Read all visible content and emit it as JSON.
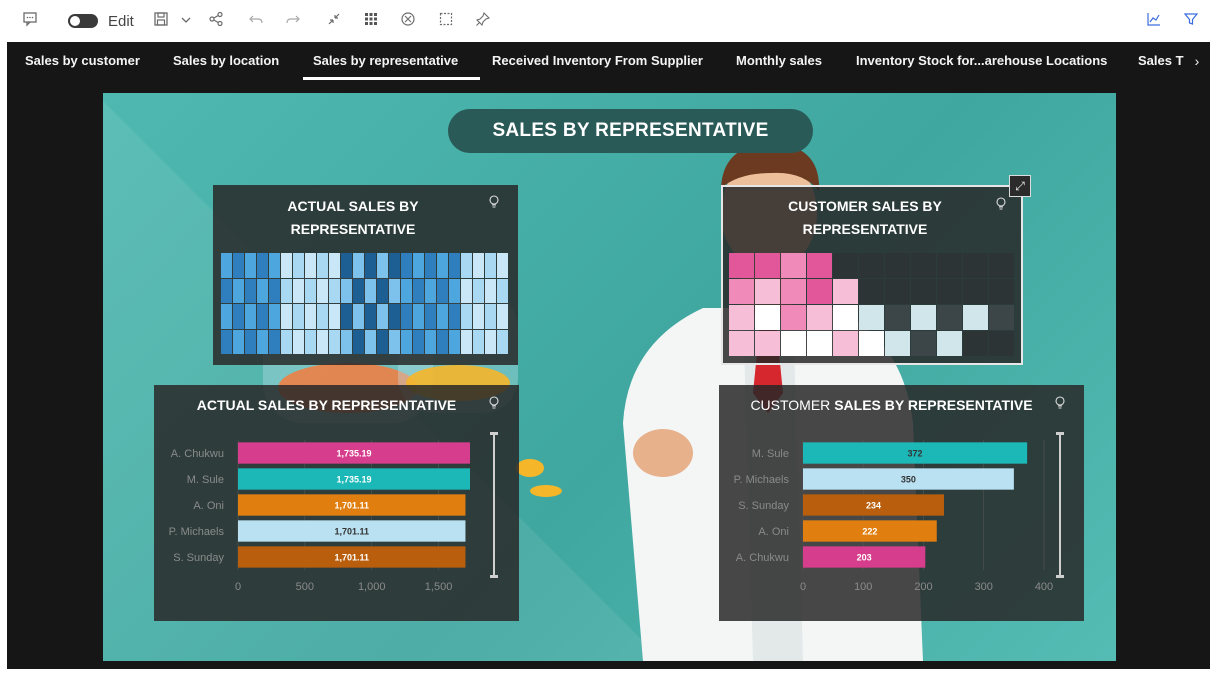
{
  "toolbar": {
    "edit_label": "Edit",
    "icons": [
      "comment-icon",
      "toggle",
      "save-icon",
      "chevron-down-icon",
      "share-icon",
      "undo-icon",
      "redo-icon",
      "fit-icon",
      "grid-icon",
      "target-icon",
      "select-icon",
      "pin-icon",
      "line-chart-icon",
      "filter-icon"
    ]
  },
  "tabs": [
    {
      "label": "Sales by customer",
      "active": false
    },
    {
      "label": "Sales by location",
      "active": false
    },
    {
      "label": "Sales by representative",
      "active": true
    },
    {
      "label": "Received Inventory From Supplier",
      "active": false
    },
    {
      "label": "Monthly sales",
      "active": false
    },
    {
      "label": "Inventory Stock for...arehouse Locations",
      "active": false
    },
    {
      "label": "Sales T",
      "active": false
    }
  ],
  "board": {
    "title": "SALES BY REPRESENTATIVE"
  },
  "panels": {
    "heat_left_title_1": "ACTUAL SALES BY",
    "heat_left_title_2": "REPRESENTATIVE",
    "heat_right_title_1": "CUSTOMER SALES BY",
    "heat_right_title_2": "REPRESENTATIVE",
    "bar_left_title": "ACTUAL SALES BY REPRESENTATIVE",
    "bar_right_title_a": "CUSTOMER ",
    "bar_right_title_b": "SALES BY REPRESENTATIVE"
  },
  "chart_data": [
    {
      "type": "bar",
      "orientation": "horizontal",
      "title": "ACTUAL SALES BY REPRESENTATIVE",
      "categories": [
        "A. Chukwu",
        "M. Sule",
        "A. Oni",
        "P. Michaels",
        "S. Sunday"
      ],
      "values": [
        1735.19,
        1735.19,
        1701.11,
        1701.11,
        1701.11
      ],
      "labels": [
        "1,735.19",
        "1,735.19",
        "1,701.11",
        "1,701.11",
        "1,701.11"
      ],
      "colors": [
        "#d63d8c",
        "#1cb8b8",
        "#e07f10",
        "#b9e1f2",
        "#b85e0c"
      ],
      "label_colors": [
        "#ffffff",
        "#ffffff",
        "#ffffff",
        "#333333",
        "#ffffff"
      ],
      "xlim": [
        0,
        1750
      ],
      "ticks": [
        0,
        500,
        1000,
        1500
      ],
      "tick_labels": [
        "0",
        "500",
        "1,000",
        "1,500"
      ]
    },
    {
      "type": "bar",
      "orientation": "horizontal",
      "title": "CUSTOMER SALES BY REPRESENTATIVE",
      "categories": [
        "M. Sule",
        "P. Michaels",
        "S. Sunday",
        "A. Oni",
        "A. Chukwu"
      ],
      "values": [
        372,
        350,
        234,
        222,
        203
      ],
      "labels": [
        "372",
        "350",
        "234",
        "222",
        "203"
      ],
      "colors": [
        "#1cb8b8",
        "#b9e1f2",
        "#b85e0c",
        "#e07f10",
        "#d63d8c"
      ],
      "label_colors": [
        "#333333",
        "#333333",
        "#ffffff",
        "#ffffff",
        "#ffffff"
      ],
      "xlim": [
        0,
        400
      ],
      "ticks": [
        0,
        100,
        200,
        300,
        400
      ],
      "tick_labels": [
        "0",
        "100",
        "200",
        "300",
        "400"
      ]
    }
  ]
}
